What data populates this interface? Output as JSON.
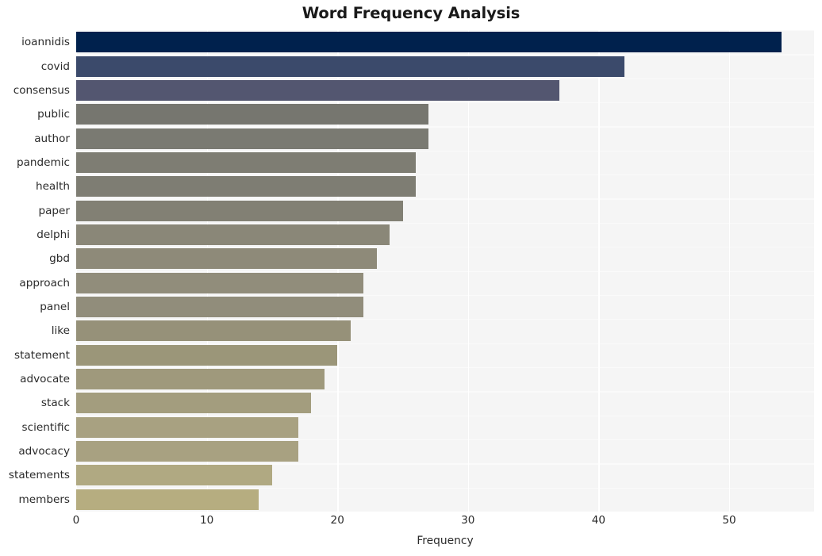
{
  "chart_data": {
    "type": "bar",
    "orientation": "horizontal",
    "title": "Word Frequency Analysis",
    "xlabel": "Frequency",
    "ylabel": "",
    "categories": [
      "ioannidis",
      "covid",
      "consensus",
      "public",
      "author",
      "pandemic",
      "health",
      "paper",
      "delphi",
      "gbd",
      "approach",
      "panel",
      "like",
      "statement",
      "advocate",
      "stack",
      "scientific",
      "advocacy",
      "statements",
      "members"
    ],
    "values": [
      54,
      42,
      37,
      27,
      27,
      26,
      26,
      25,
      24,
      23,
      22,
      22,
      21,
      20,
      19,
      18,
      17,
      17,
      15,
      14
    ],
    "bar_colors": [
      "#00214d",
      "#3b4a6b",
      "#535670",
      "#76766f",
      "#7a7a72",
      "#7e7d73",
      "#7e7d73",
      "#828074",
      "#8a8778",
      "#8e8a79",
      "#918d7b",
      "#918d7b",
      "#969179",
      "#9b9679",
      "#9f997c",
      "#a39d7e",
      "#a8a181",
      "#a8a181",
      "#b0a982",
      "#b6ad80"
    ],
    "xlim": [
      0,
      56.5
    ],
    "xticks": [
      0,
      10,
      20,
      30,
      40,
      50
    ],
    "xtick_labels": [
      "0",
      "10",
      "20",
      "30",
      "40",
      "50"
    ],
    "grid": true,
    "grid_axis": "both",
    "legend": null,
    "colormap": "cividis",
    "plot_background": "#f5f5f5",
    "grid_color": "#ffffff",
    "figure_background": "#ffffff"
  }
}
